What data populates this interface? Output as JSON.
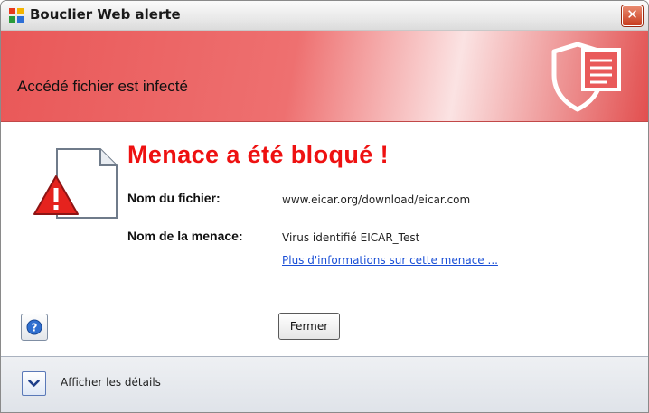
{
  "window": {
    "title": "Bouclier Web alerte",
    "close_glyph": "✕",
    "app_icon": "avg-logo-icon"
  },
  "banner": {
    "title": "Accédé fichier est infecté",
    "icon": "shield-document-icon"
  },
  "alert": {
    "icon": "warning-document-icon",
    "headline": "Menace a été bloqué !",
    "file_label": "Nom du fichier:",
    "file_value": "www.eicar.org/download/eicar.com",
    "threat_label": "Nom de la menace:",
    "threat_value": "Virus identifié EICAR_Test",
    "more_info_link": "Plus d'informations sur cette menace ..."
  },
  "actions": {
    "help_icon": "help-icon",
    "close_label": "Fermer"
  },
  "footer": {
    "expand_icon": "chevron-down-icon",
    "details_label": "Afficher les détails"
  },
  "colors": {
    "banner_red": "#e95858",
    "headline_red": "#ee1111",
    "link_blue": "#1a4fd6",
    "title_close_red": "#c83d1f"
  }
}
